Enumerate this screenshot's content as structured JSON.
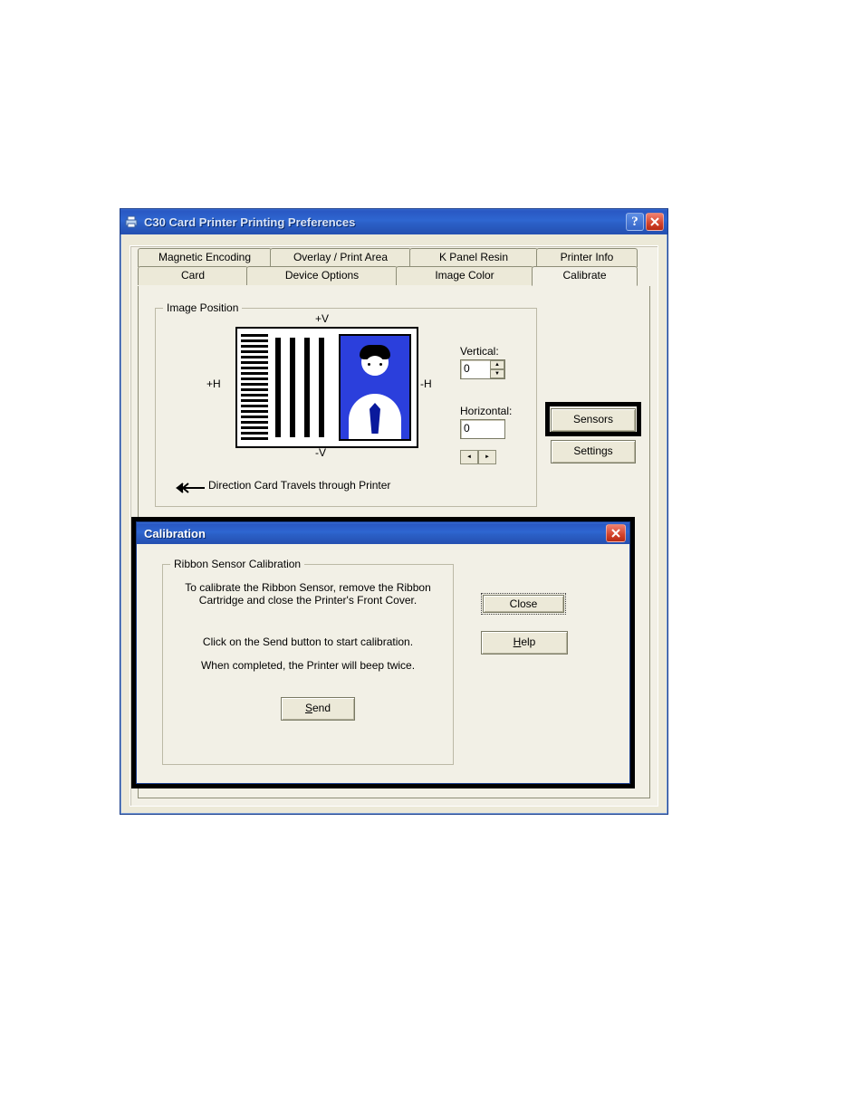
{
  "window": {
    "title": "C30 Card Printer Printing Preferences"
  },
  "tabs": {
    "row1": [
      "Magnetic Encoding",
      "Overlay / Print Area",
      "K Panel Resin",
      "Printer Info"
    ],
    "row2": [
      "Card",
      "Device Options",
      "Image Color",
      "Calibrate"
    ],
    "active": "Calibrate"
  },
  "image_position": {
    "legend": "Image Position",
    "axis": {
      "v_plus": "+V",
      "v_minus": "-V",
      "h_plus": "+H",
      "h_minus": "-H"
    },
    "direction_note": "Direction Card Travels through Printer",
    "vertical_label": "Vertical:",
    "vertical_value": "0",
    "horizontal_label": "Horizontal:",
    "horizontal_value": "0"
  },
  "buttons": {
    "sensors": "Sensors",
    "settings": "Settings"
  },
  "calibration_dialog": {
    "title": "Calibration",
    "group_legend": "Ribbon Sensor Calibration",
    "line1": "To calibrate the Ribbon Sensor, remove the Ribbon Cartridge and close the Printer's Front Cover.",
    "line2": "Click on the Send button to start calibration.",
    "line3": "When completed, the Printer will beep twice.",
    "send": "Send",
    "close": "Close",
    "help": "Help"
  }
}
